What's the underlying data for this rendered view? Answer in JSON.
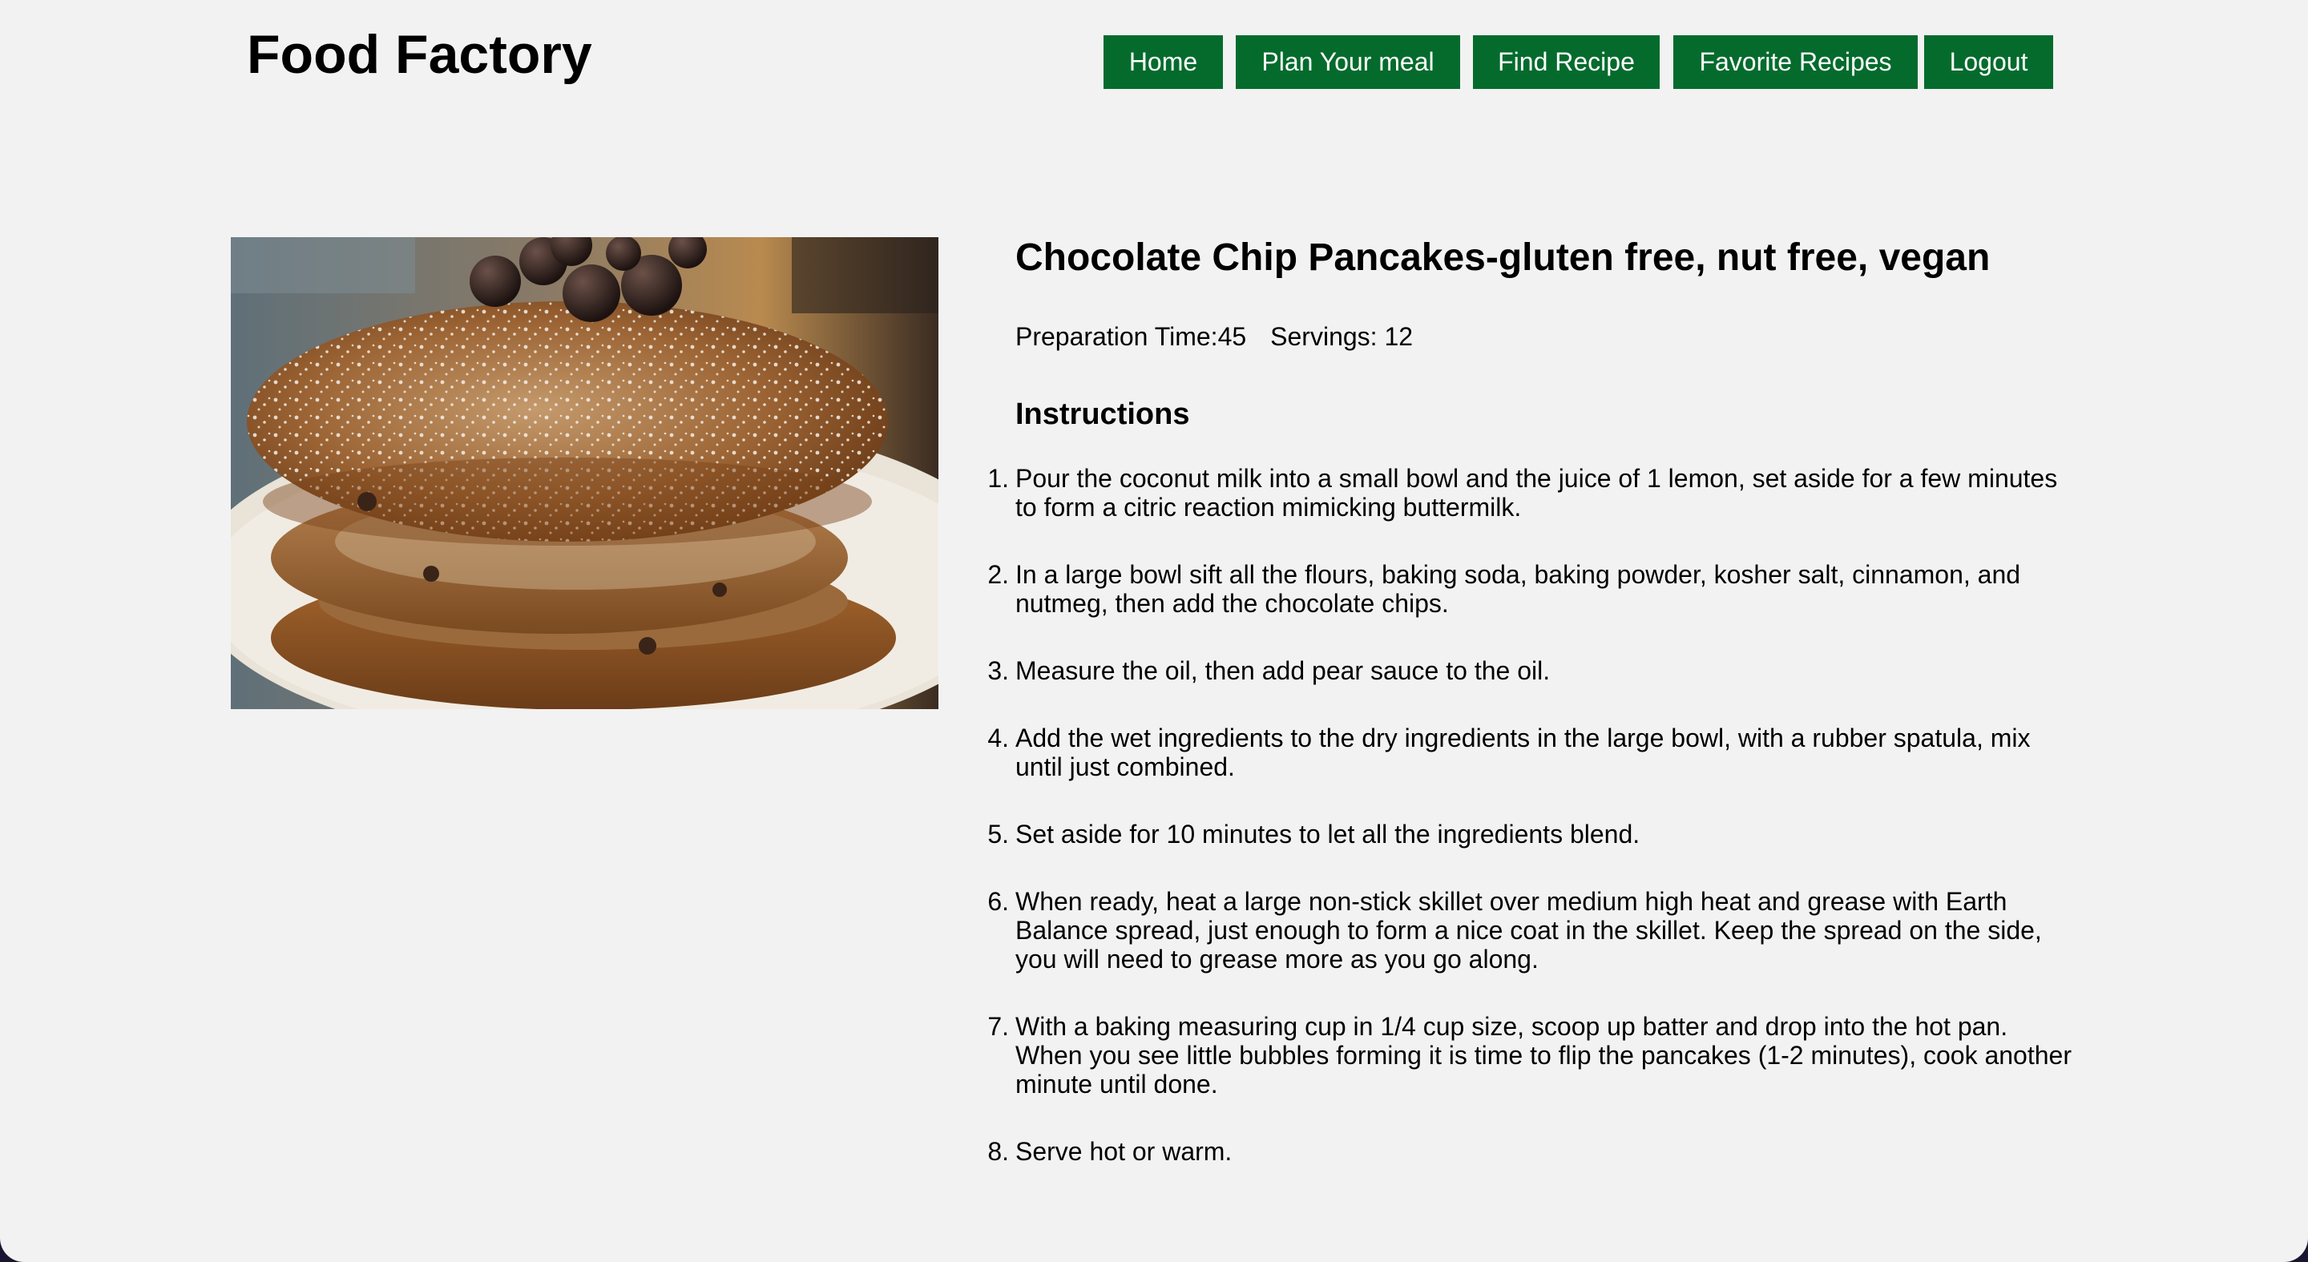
{
  "header": {
    "logo": "Food Factory",
    "nav": [
      {
        "label": "Home",
        "name": "nav-home-button"
      },
      {
        "label": "Plan Your meal",
        "name": "nav-plan-meal-button"
      },
      {
        "label": "Find Recipe",
        "name": "nav-find-recipe-button"
      },
      {
        "label": "Favorite Recipes",
        "name": "nav-favorite-recipes-button"
      },
      {
        "label": "Logout",
        "name": "nav-logout-button"
      }
    ]
  },
  "colors": {
    "nav_background": "#046b2d",
    "nav_text": "#ffffff",
    "page_background": "#f2f2f2"
  },
  "recipe": {
    "title": "Chocolate Chip Pancakes-gluten free, nut free, vegan",
    "prep_time": "Preparation Time:45",
    "servings": "Servings: 12",
    "instructions_heading": "Instructions",
    "steps": [
      {
        "num": "1.",
        "text": "Pour the coconut milk into a small bowl and the juice of 1 lemon, set aside for a few minutes to form a citric reaction mimicking buttermilk."
      },
      {
        "num": "2.",
        "text": "In a large bowl sift all the flours, baking soda, baking powder, kosher salt, cinnamon, and nutmeg, then add the chocolate chips."
      },
      {
        "num": "3.",
        "text": "Measure the oil, then add pear sauce to the oil."
      },
      {
        "num": "4.",
        "text": "Add the wet ingredients to the dry ingredients in the large bowl, with a rubber spatula, mix until just combined."
      },
      {
        "num": "5.",
        "text": "Set aside for 10 minutes to let all the ingredients blend."
      },
      {
        "num": "6.",
        "text": "When ready, heat a large non-stick skillet over medium high heat and grease with Earth Balance spread, just enough to form a nice coat in the skillet. Keep the spread on the side, you will need to grease more as you go along."
      },
      {
        "num": "7.",
        "text": "With a baking measuring cup in 1/4 cup size, scoop up batter and drop into the hot pan. When you see little bubbles forming it is time to flip the pancakes (1-2 minutes), cook another minute until done."
      },
      {
        "num": "8.",
        "text": "Serve hot or warm."
      }
    ]
  }
}
